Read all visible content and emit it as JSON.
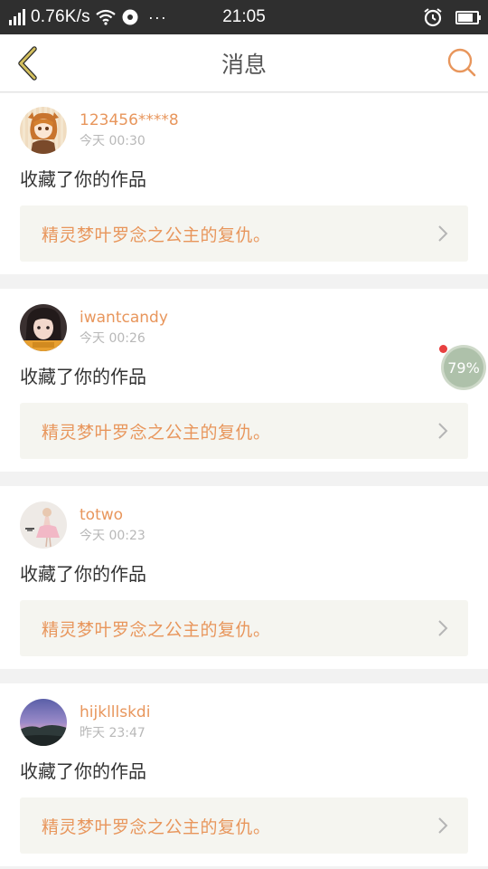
{
  "status_bar": {
    "speed": "0.76K/s",
    "dots": "···",
    "time": "21:05",
    "battery_level": 0.8
  },
  "header": {
    "title": "消息"
  },
  "messages": [
    {
      "username": "123456****8",
      "time": "今天 00:30",
      "action": "收藏了你的作品",
      "work_title": "精灵梦叶罗念之公主的复仇。",
      "avatar": "anime-girl-avatar"
    },
    {
      "username": "iwantcandy",
      "time": "今天 00:26",
      "action": "收藏了你的作品",
      "work_title": "精灵梦叶罗念之公主的复仇。",
      "avatar": "dark-hair-girl-avatar"
    },
    {
      "username": "totwo",
      "time": "今天 00:23",
      "action": "收藏了你的作品",
      "work_title": "精灵梦叶罗念之公主的复仇。",
      "avatar": "pink-dress-avatar"
    },
    {
      "username": "hijklllskdi",
      "time": "昨天 23:47",
      "action": "收藏了你的作品",
      "work_title": "精灵梦叶罗念之公主的复仇。",
      "avatar": "sunset-landscape-avatar"
    }
  ],
  "floating_badge": {
    "label": "79%"
  },
  "colors": {
    "accent": "#e8965c",
    "back_arrow": "#c8b45a",
    "status_bar_bg": "#2f2f2f"
  }
}
